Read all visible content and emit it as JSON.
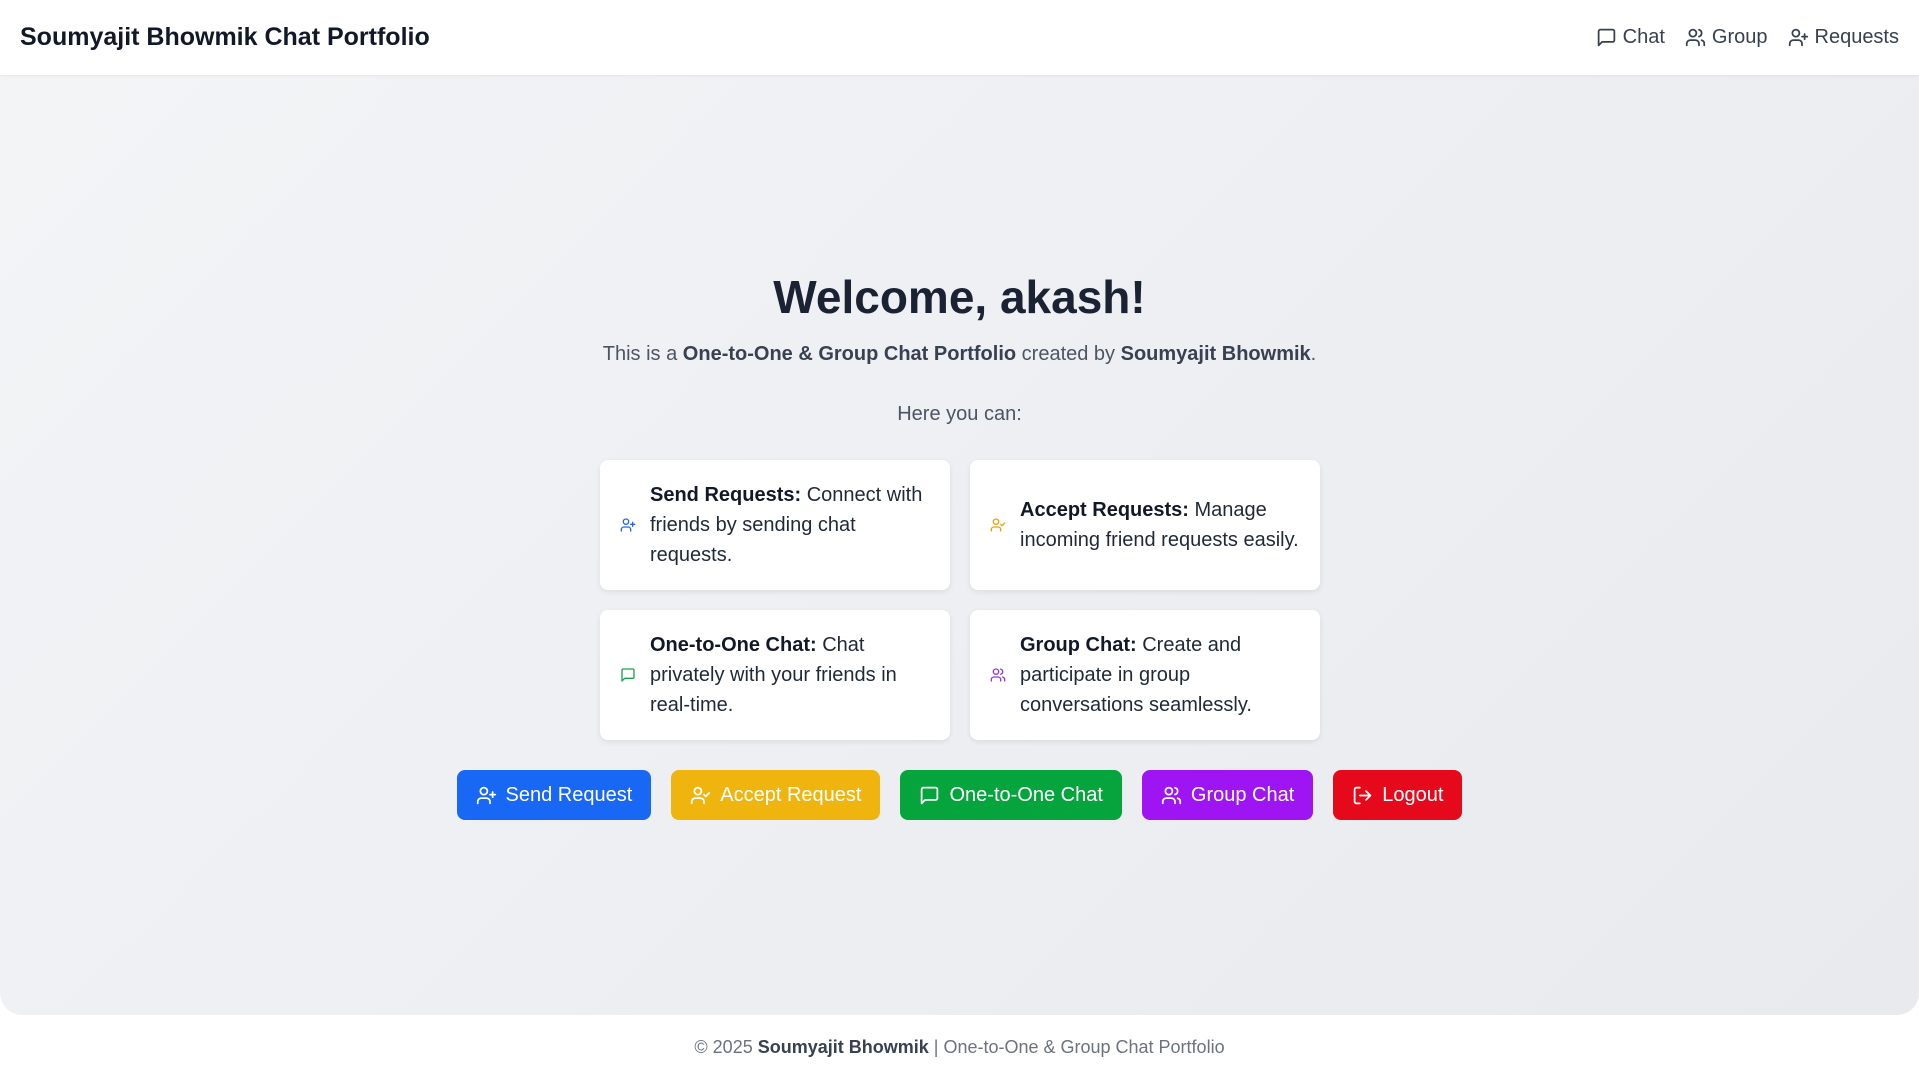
{
  "header": {
    "brand": "Soumyajit Bhowmik Chat Portfolio",
    "nav": [
      {
        "label": "Chat",
        "icon": "message-square-icon"
      },
      {
        "label": "Group",
        "icon": "users-icon"
      },
      {
        "label": "Requests",
        "icon": "user-plus-icon"
      }
    ]
  },
  "welcome": {
    "title": "Welcome, akash!",
    "intro_prefix": "This is a ",
    "intro_project": "One-to-One & Group Chat Portfolio",
    "intro_middle": " created by ",
    "intro_author": "Soumyajit Bhowmik",
    "intro_suffix": ".",
    "here": "Here you can:"
  },
  "features": [
    {
      "title": "Send Requests:",
      "text": " Connect with friends by sending chat requests.",
      "icon": "user-plus-icon",
      "color": "#2563eb"
    },
    {
      "title": "Accept Requests:",
      "text": " Manage incoming friend requests easily.",
      "icon": "user-check-icon",
      "color": "#f59e0b"
    },
    {
      "title": "One-to-One Chat:",
      "text": " Chat privately with your friends in real-time.",
      "icon": "message-square-icon",
      "color": "#16a34a"
    },
    {
      "title": "Group Chat:",
      "text": " Create and participate in group conversations seamlessly.",
      "icon": "users-icon",
      "color": "#9333ea"
    }
  ],
  "buttons": [
    {
      "label": "Send Request",
      "icon": "user-plus-icon",
      "color": "#1967f5"
    },
    {
      "label": "Accept Request",
      "icon": "user-check-icon",
      "color": "#f0b40f"
    },
    {
      "label": "One-to-One Chat",
      "icon": "message-square-icon",
      "color": "#06a43c"
    },
    {
      "label": "Group Chat",
      "icon": "users-icon",
      "color": "#9e14f2"
    },
    {
      "label": "Logout",
      "icon": "logout-icon",
      "color": "#e6091b"
    }
  ],
  "footer": {
    "copyright": "© 2025 ",
    "author": "Soumyajit Bhowmik",
    "separator": " | ",
    "project": "One-to-One & Group Chat Portfolio"
  }
}
